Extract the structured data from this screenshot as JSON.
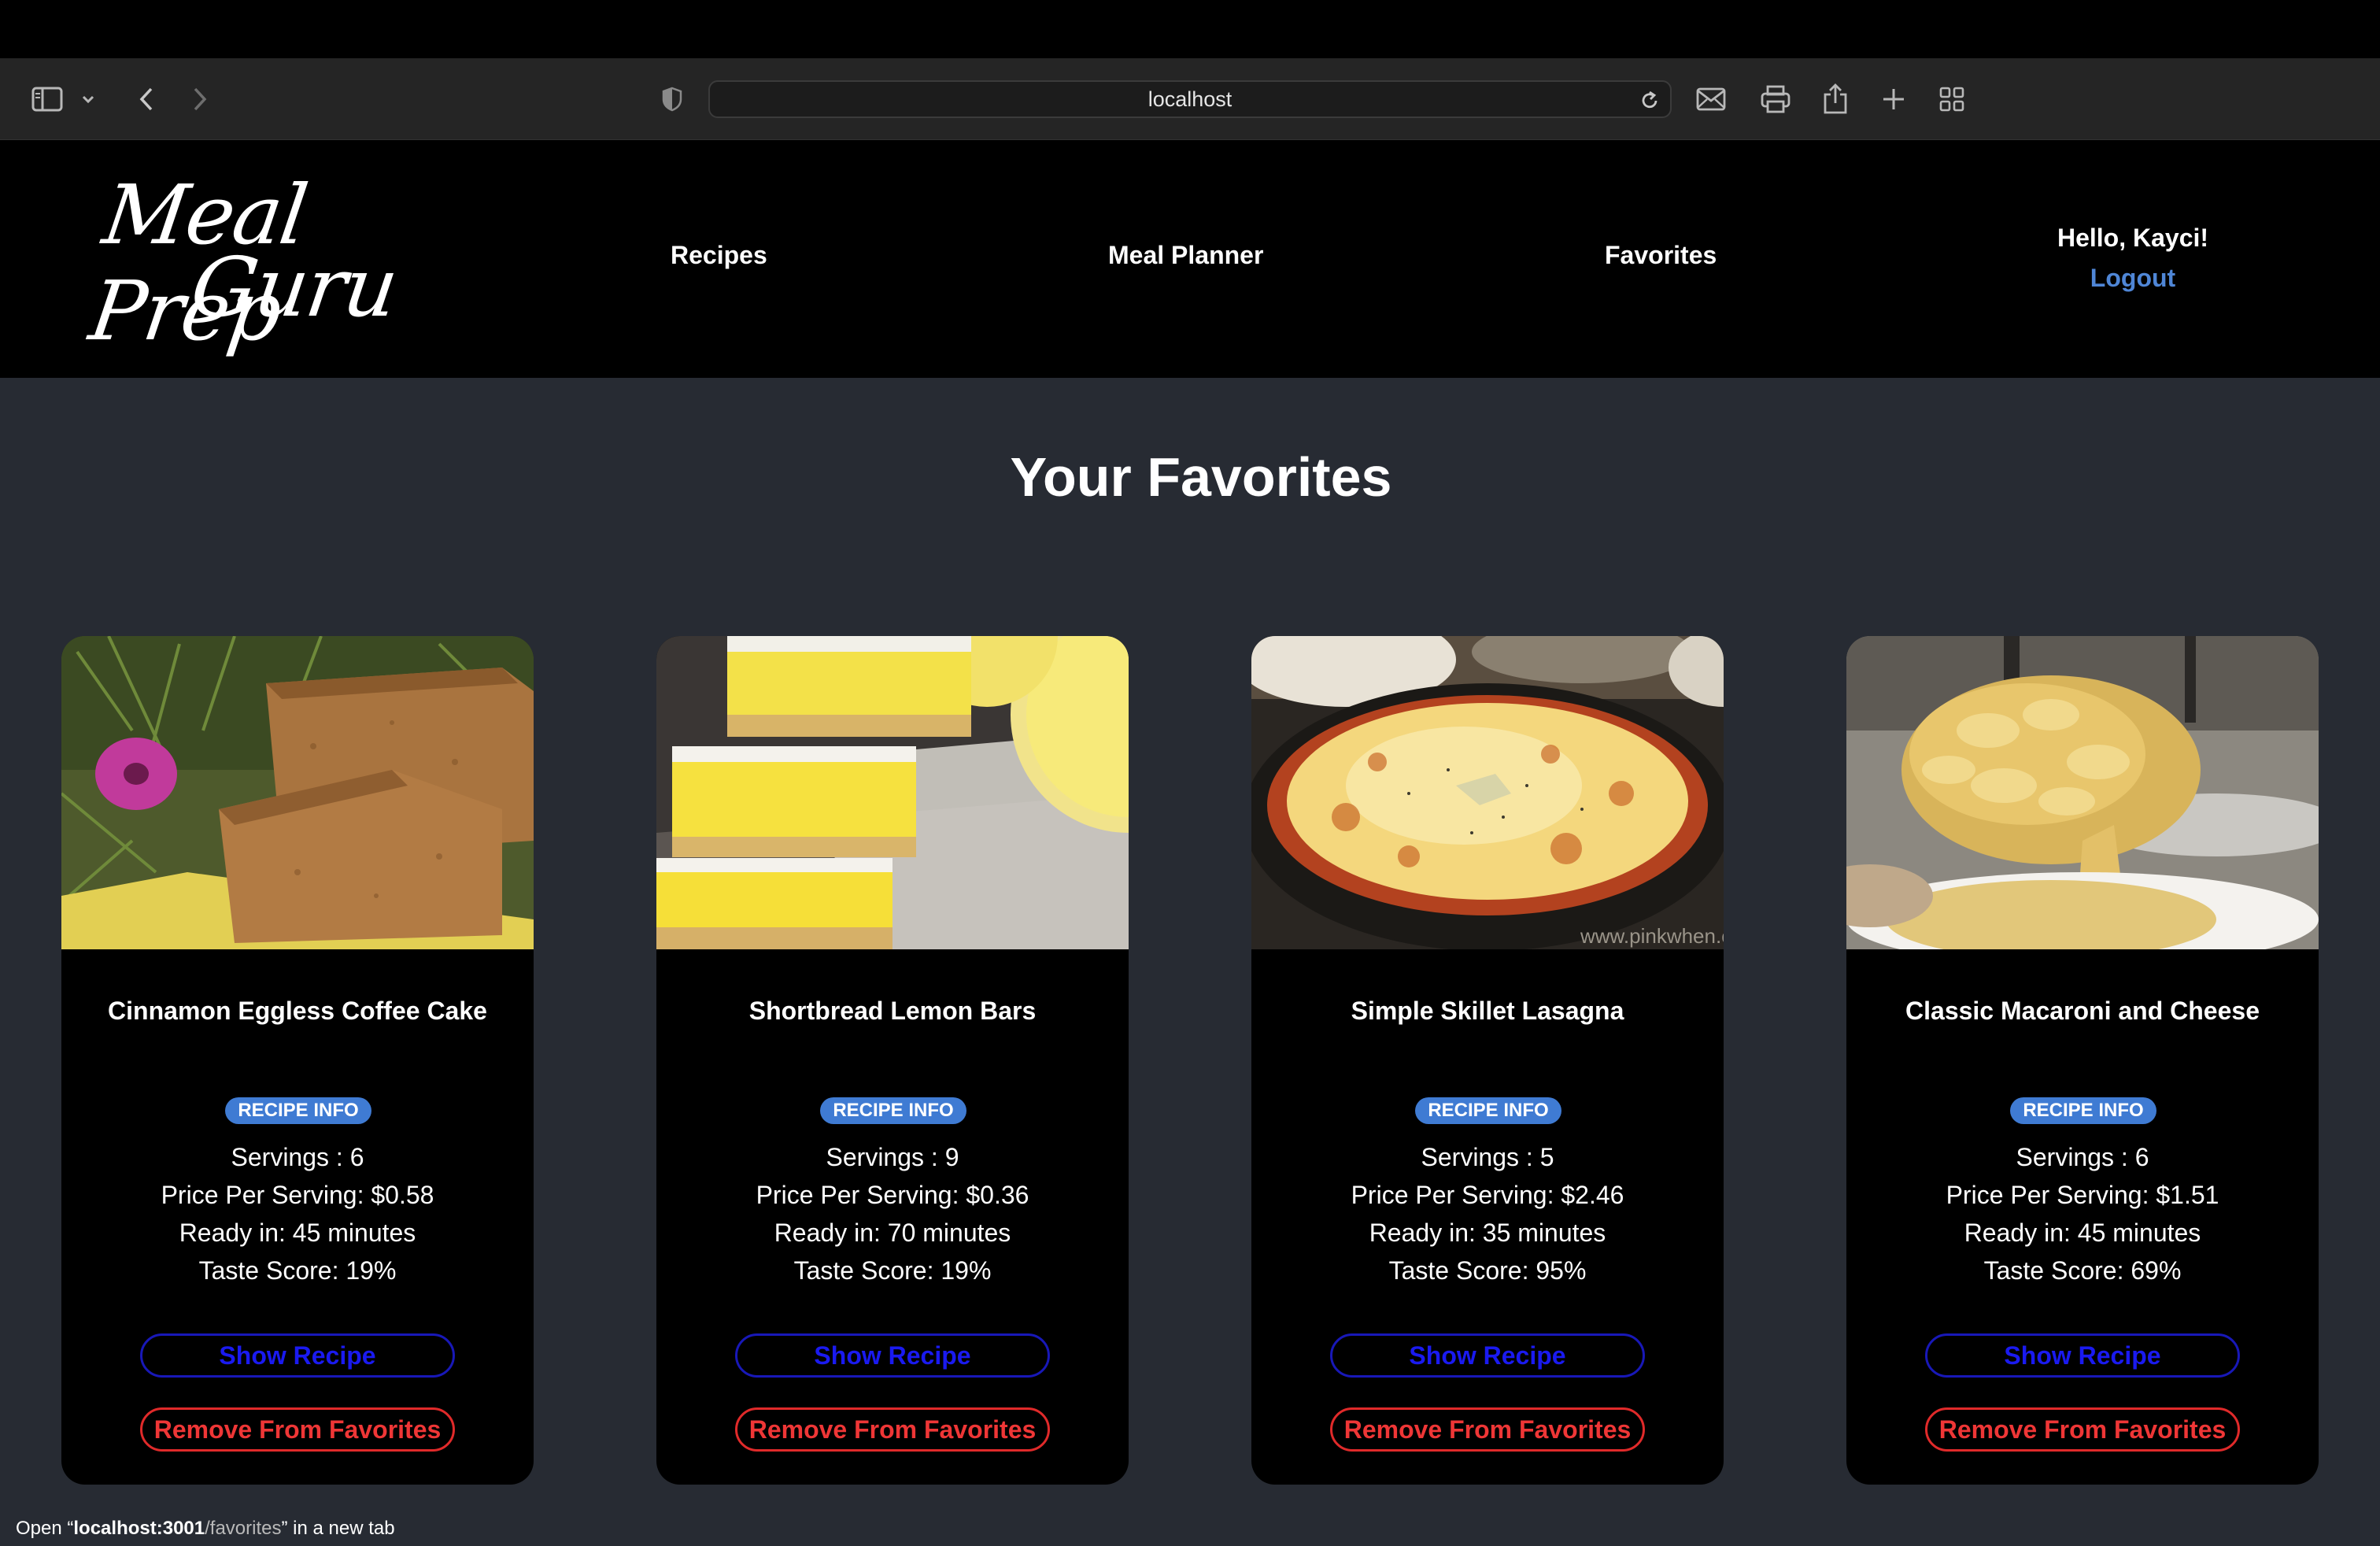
{
  "browser": {
    "address": "localhost",
    "status_prefix": "Open “",
    "status_host": "localhost:3001",
    "status_path": "/favorites",
    "status_suffix": "” in a new tab"
  },
  "header": {
    "logo_line1": "Meal Prep",
    "logo_line2": "Guru",
    "nav": [
      "Recipes",
      "Meal Planner",
      "Favorites"
    ],
    "greeting": "Hello, Kayci!",
    "logout": "Logout"
  },
  "main": {
    "title": "Your Favorites",
    "badge": "RECIPE INFO",
    "show_label": "Show Recipe",
    "remove_label": "Remove From Favorites",
    "cards": [
      {
        "title": "Cinnamon Eggless Coffee Cake",
        "servings": "Servings : 6",
        "price": "Price Per Serving: $0.58",
        "ready": "Ready in: 45 minutes",
        "taste": "Taste Score: 19%"
      },
      {
        "title": "Shortbread Lemon Bars",
        "servings": "Servings : 9",
        "price": "Price Per Serving: $0.36",
        "ready": "Ready in: 70 minutes",
        "taste": "Taste Score: 19%"
      },
      {
        "title": "Simple Skillet Lasagna",
        "servings": "Servings : 5",
        "price": "Price Per Serving: $2.46",
        "ready": "Ready in: 35 minutes",
        "taste": "Taste Score: 95%",
        "watermark": "www.pinkwhen.com"
      },
      {
        "title": "Classic Macaroni and Cheese",
        "servings": "Servings : 6",
        "price": "Price Per Serving: $1.51",
        "ready": "Ready in: 45 minutes",
        "taste": "Taste Score: 69%"
      }
    ]
  },
  "colors": {
    "page_bg": "#272b33",
    "header_bg": "#000000",
    "logout": "#4f86d6",
    "badge": "#3f7bd3",
    "show_button": "#1a1af0",
    "remove_button": "#ef3636"
  }
}
